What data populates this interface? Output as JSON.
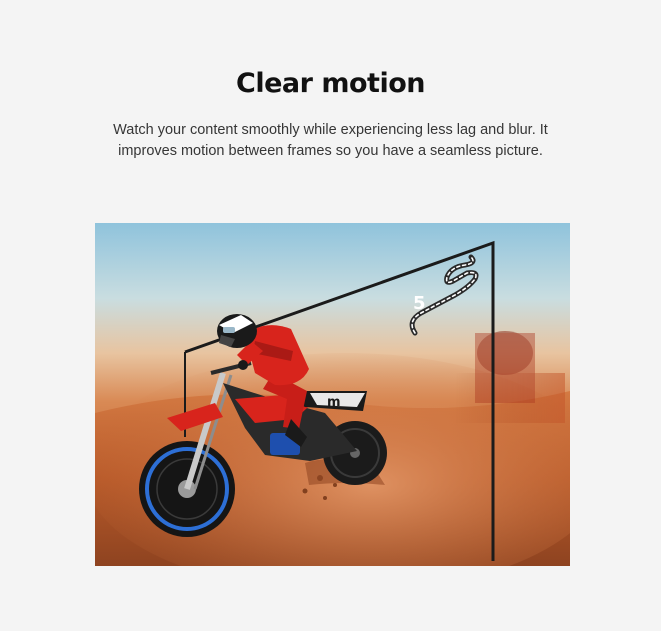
{
  "heading": "Clear motion",
  "description": "Watch your content smoothly while experiencing less lag and blur. It improves motion between frames so you have a seamless picture.",
  "hero_image": {
    "subject": "motocross-rider-jumping-out-of-tv-frame",
    "hud_lap_number": "5",
    "rider_number": "m"
  },
  "colors": {
    "background": "#f4f4f4",
    "heading": "#111111",
    "body_text": "#363636",
    "sky_top": "#8fc3dc",
    "dust": "#c86a34",
    "rider_suit": "#d8241c"
  }
}
